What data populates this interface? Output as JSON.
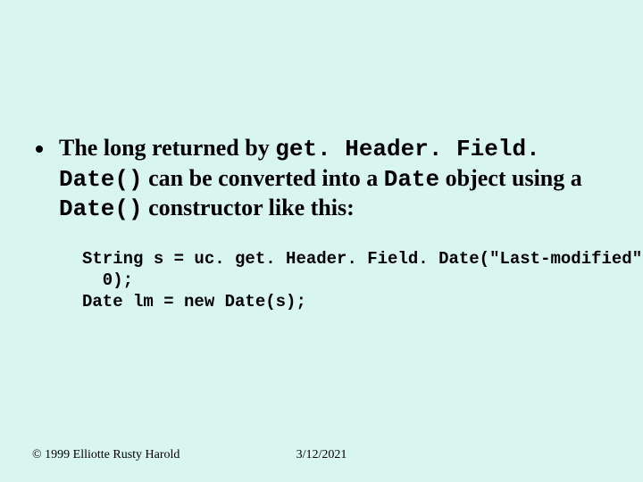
{
  "bullet": {
    "t1": "The long returned by ",
    "code1": "get. Header. Field. Date()",
    "t2": " can be converted into a ",
    "code2": "Date",
    "t3": " object using a ",
    "code3": "Date()",
    "t4": " constructor like this:"
  },
  "code": "String s = uc. get. Header. Field. Date(\"Last-modified\",\n  0);\nDate lm = new Date(s);",
  "footer": {
    "copyright": "© 1999 Elliotte Rusty Harold",
    "date": "3/12/2021"
  }
}
